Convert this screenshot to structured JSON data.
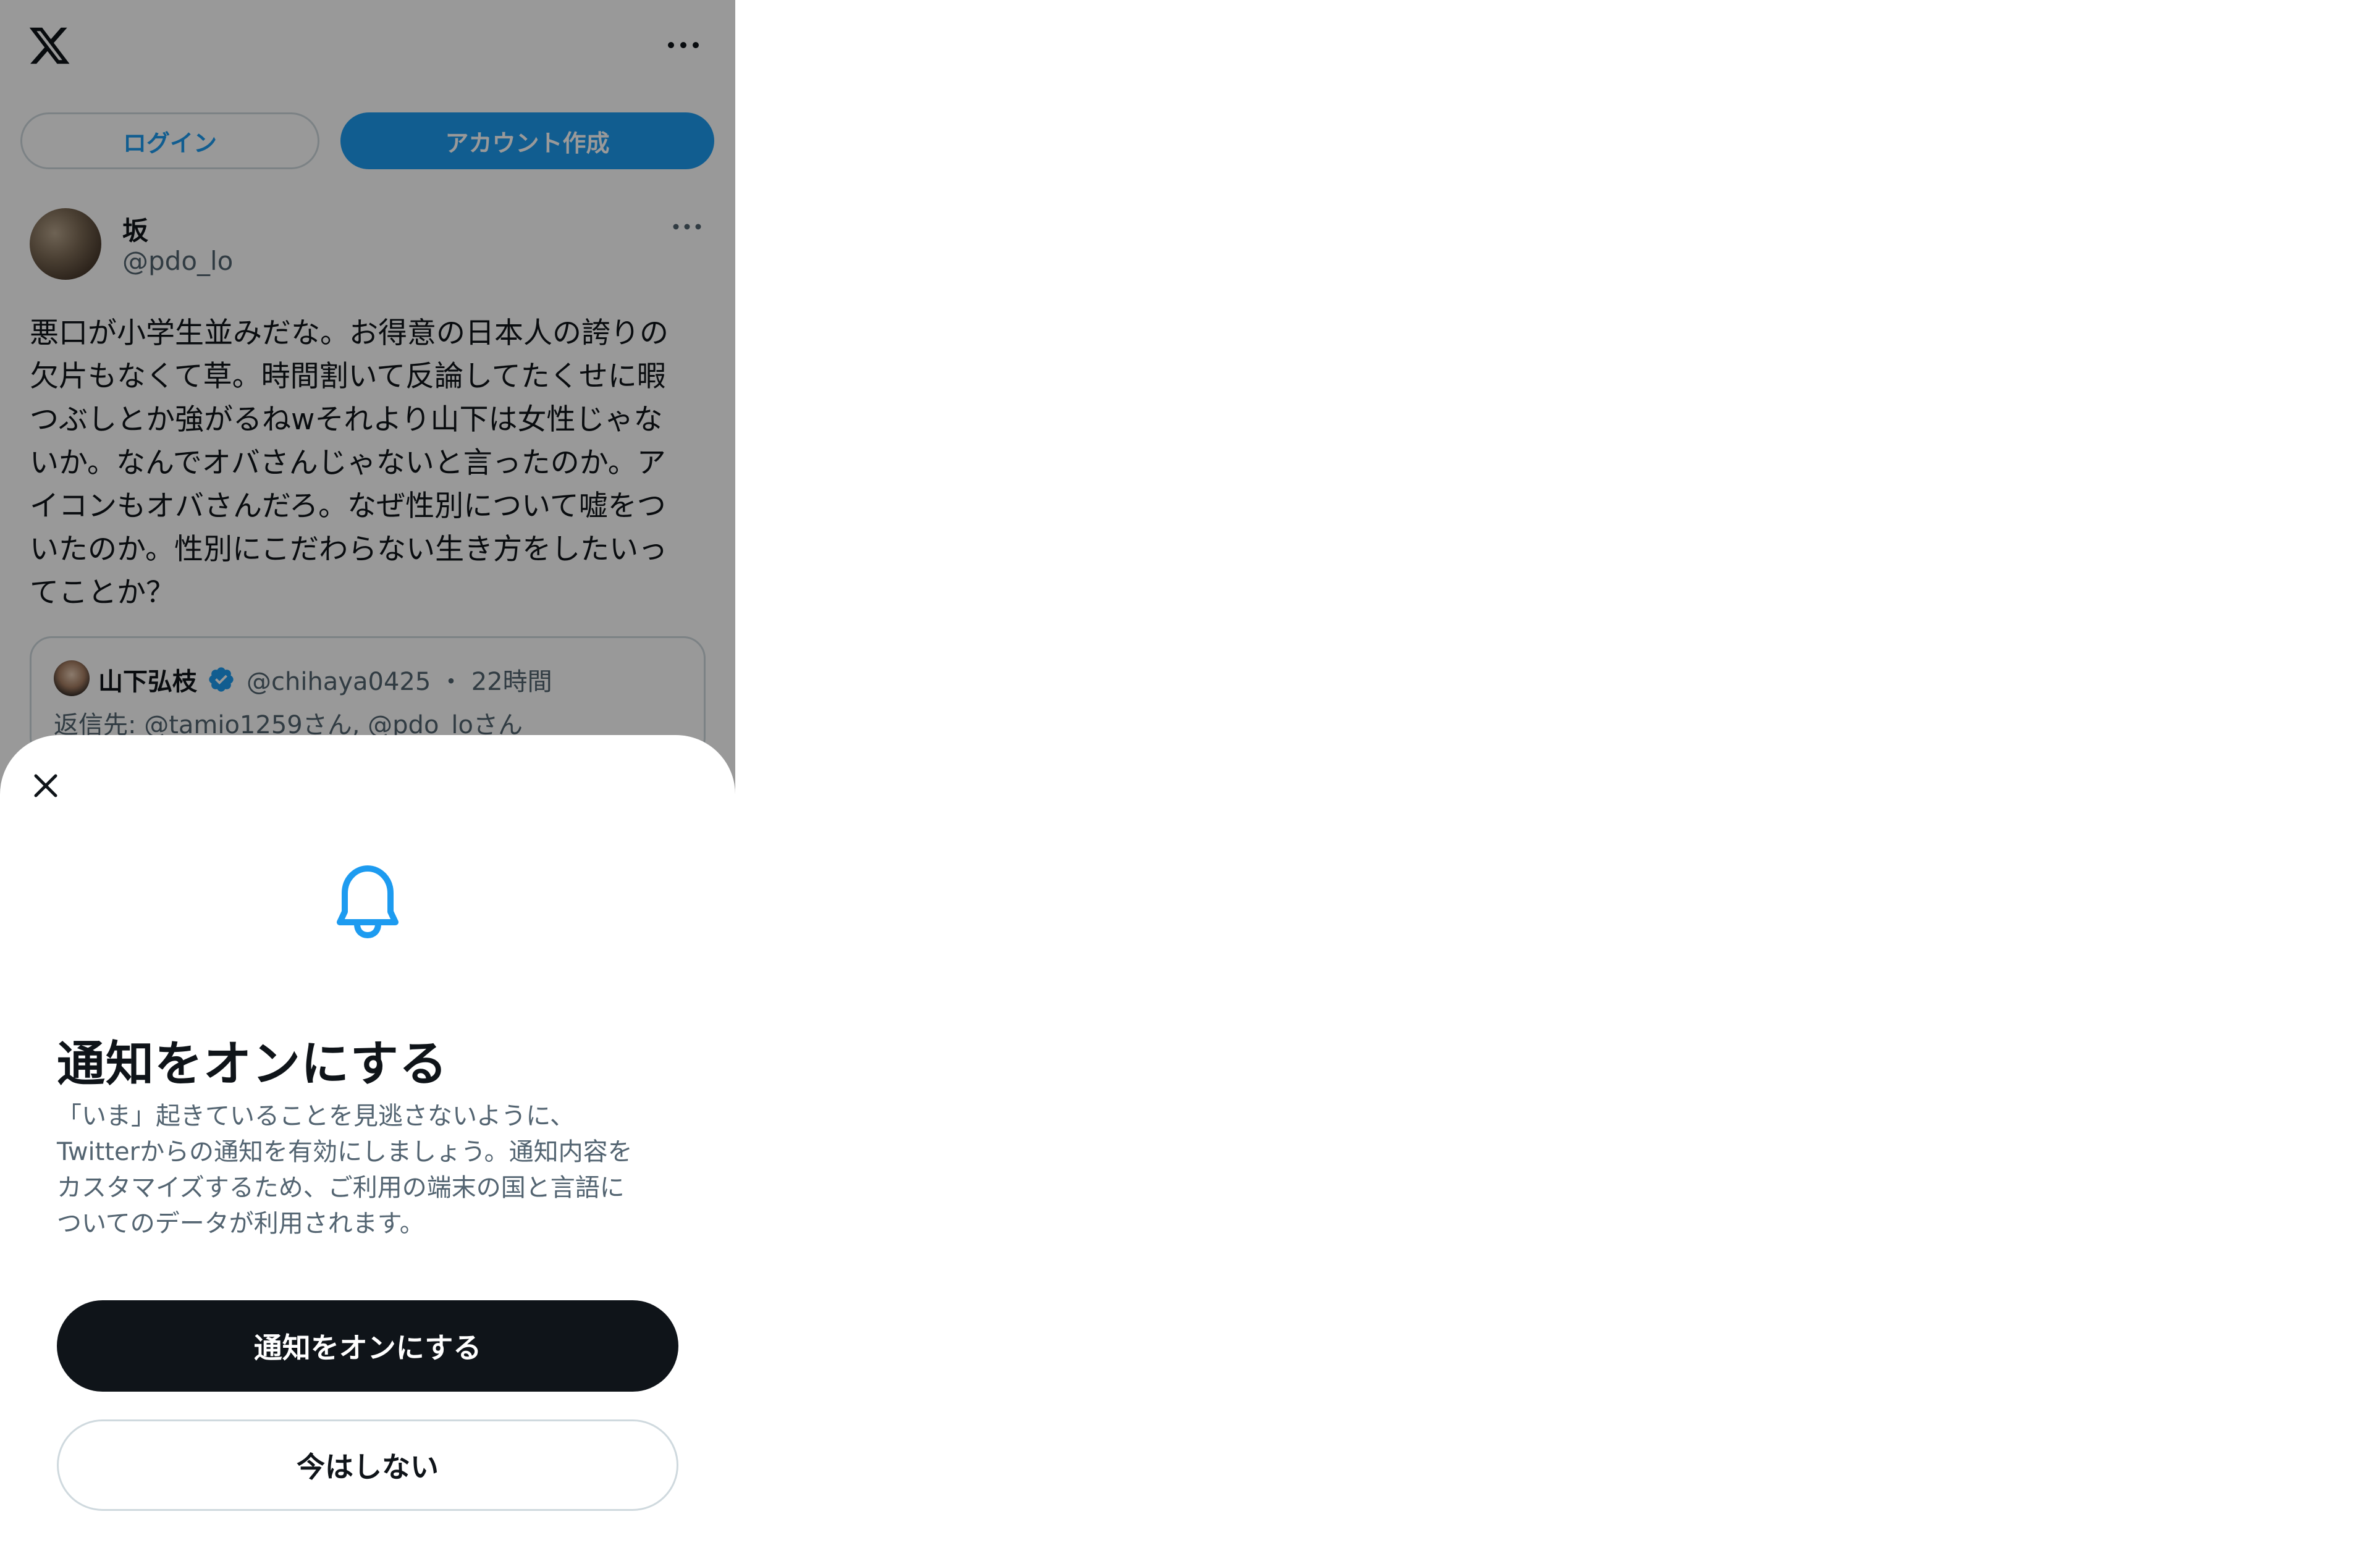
{
  "header": {
    "logo_icon": "x-logo-icon",
    "more_icon": "more-horizontal-icon",
    "login_label": "ログイン",
    "signup_label": "アカウント作成"
  },
  "tweet": {
    "author_name": "坂",
    "author_handle": "@pdo_lo",
    "text": "悪口が小学生並みだな。お得意の日本人の誇りの\n欠片もなくて草。時間割いて反論してたくせに暇\nつぶしとか強がるねwそれより山下は女性じゃな\nいか。なんでオバさんじゃないと言ったのか。ア\nイコンもオバさんだろ。なぜ性別について嘘をつ\nいたのか。性別にこだわらない生き方をしたいっ\nてことか？",
    "quote": {
      "name": "山下弘枝",
      "handle_time": "@chihaya0425 ・ 22時間",
      "reply_to": "返信先: @tamio1259さん, @pdo_loさん"
    }
  },
  "sheet": {
    "close_icon": "close-icon",
    "bell_icon": "bell-icon",
    "title": "通知をオンにする",
    "description": "「いま」起きていることを見逃さないように、\nTwitterからの通知を有効にしましょう。通知内容を\nカスタマイズするため、ご利用の端末の国と言語に\nついてのデータが利用されます。",
    "primary_button": "通知をオンにする",
    "secondary_button": "今はしない"
  },
  "colors": {
    "accent": "#1d9bf0",
    "dark_button": "#0f1419",
    "muted_text": "#536471",
    "border": "#cfd9de"
  }
}
